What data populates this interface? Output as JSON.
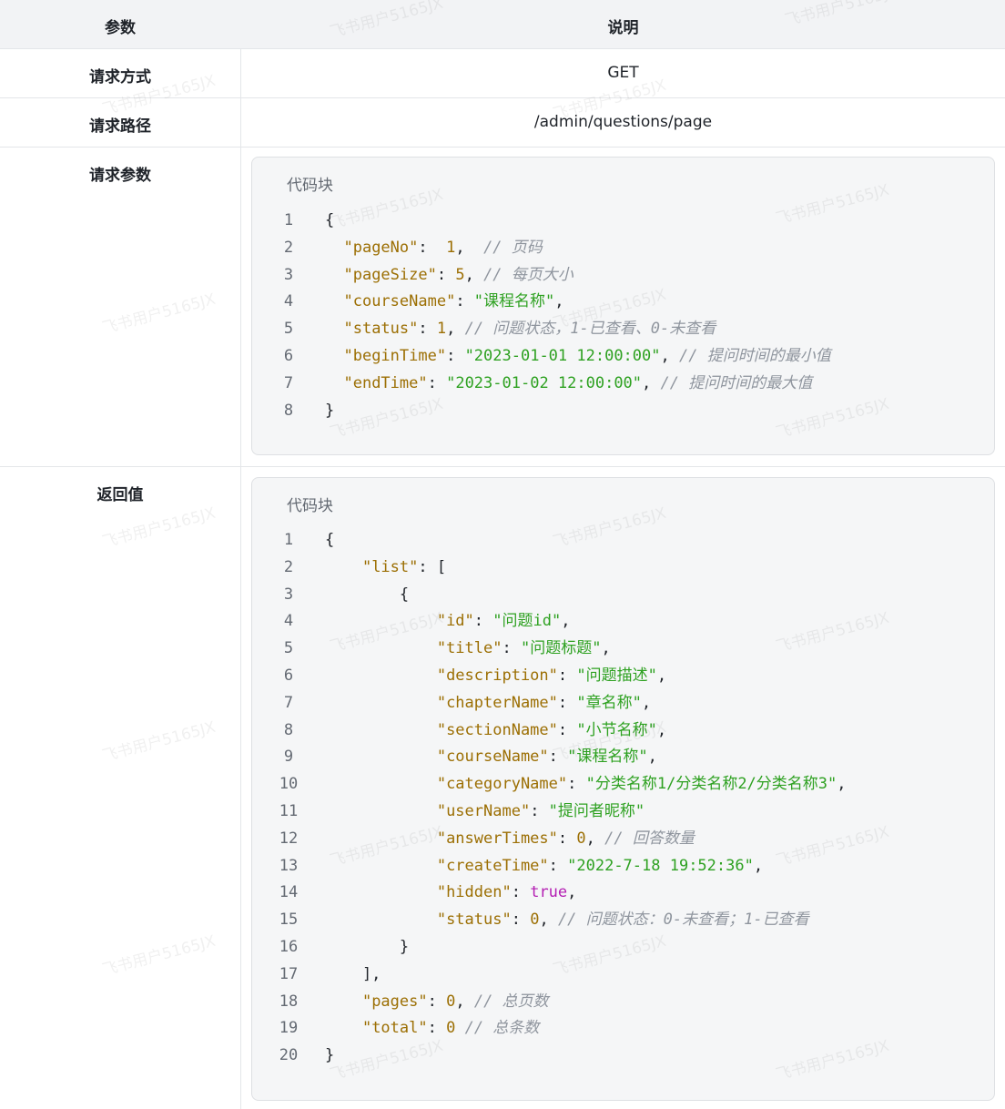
{
  "table": {
    "header": {
      "param": "参数",
      "desc": "说明"
    },
    "rows": [
      {
        "label": "请求方式",
        "value": "GET"
      },
      {
        "label": "请求路径",
        "value": "/admin/questions/page"
      }
    ],
    "request_params": {
      "label": "请求参数",
      "code_title": "代码块",
      "lines": [
        [
          [
            "pun",
            "{"
          ]
        ],
        [
          [
            "pun",
            "  "
          ],
          [
            "key",
            "\"pageNo\""
          ],
          [
            "pun",
            ":  "
          ],
          [
            "num",
            "1"
          ],
          [
            "pun",
            ",  "
          ],
          [
            "cmt",
            "// 页码"
          ]
        ],
        [
          [
            "pun",
            "  "
          ],
          [
            "key",
            "\"pageSize\""
          ],
          [
            "pun",
            ": "
          ],
          [
            "num",
            "5"
          ],
          [
            "pun",
            ", "
          ],
          [
            "cmt",
            "// 每页大小"
          ]
        ],
        [
          [
            "pun",
            "  "
          ],
          [
            "key",
            "\"courseName\""
          ],
          [
            "pun",
            ": "
          ],
          [
            "str",
            "\"课程名称\""
          ],
          [
            "pun",
            ","
          ]
        ],
        [
          [
            "pun",
            "  "
          ],
          [
            "key",
            "\"status\""
          ],
          [
            "pun",
            ": "
          ],
          [
            "num",
            "1"
          ],
          [
            "pun",
            ", "
          ],
          [
            "cmt",
            "// 问题状态，1-已查看、0-未查看"
          ]
        ],
        [
          [
            "pun",
            "  "
          ],
          [
            "key",
            "\"beginTime\""
          ],
          [
            "pun",
            ": "
          ],
          [
            "str",
            "\"2023-01-01 12:00:00\""
          ],
          [
            "pun",
            ", "
          ],
          [
            "cmt",
            "// 提问时间的最小值"
          ]
        ],
        [
          [
            "pun",
            "  "
          ],
          [
            "key",
            "\"endTime\""
          ],
          [
            "pun",
            ": "
          ],
          [
            "str",
            "\"2023-01-02 12:00:00\""
          ],
          [
            "pun",
            ", "
          ],
          [
            "cmt",
            "// 提问时间的最大值"
          ]
        ],
        [
          [
            "pun",
            "}"
          ]
        ]
      ]
    },
    "return_value": {
      "label": "返回值",
      "code_title": "代码块",
      "lines": [
        [
          [
            "pun",
            "{"
          ]
        ],
        [
          [
            "pun",
            "    "
          ],
          [
            "key",
            "\"list\""
          ],
          [
            "pun",
            ": ["
          ]
        ],
        [
          [
            "pun",
            "        {"
          ]
        ],
        [
          [
            "pun",
            "            "
          ],
          [
            "key",
            "\"id\""
          ],
          [
            "pun",
            ": "
          ],
          [
            "str",
            "\"问题id\""
          ],
          [
            "pun",
            ","
          ]
        ],
        [
          [
            "pun",
            "            "
          ],
          [
            "key",
            "\"title\""
          ],
          [
            "pun",
            ": "
          ],
          [
            "str",
            "\"问题标题\""
          ],
          [
            "pun",
            ","
          ]
        ],
        [
          [
            "pun",
            "            "
          ],
          [
            "key",
            "\"description\""
          ],
          [
            "pun",
            ": "
          ],
          [
            "str",
            "\"问题描述\""
          ],
          [
            "pun",
            ","
          ]
        ],
        [
          [
            "pun",
            "            "
          ],
          [
            "key",
            "\"chapterName\""
          ],
          [
            "pun",
            ": "
          ],
          [
            "str",
            "\"章名称\""
          ],
          [
            "pun",
            ","
          ]
        ],
        [
          [
            "pun",
            "            "
          ],
          [
            "key",
            "\"sectionName\""
          ],
          [
            "pun",
            ": "
          ],
          [
            "str",
            "\"小节名称\""
          ],
          [
            "pun",
            ","
          ]
        ],
        [
          [
            "pun",
            "            "
          ],
          [
            "key",
            "\"courseName\""
          ],
          [
            "pun",
            ": "
          ],
          [
            "str",
            "\"课程名称\""
          ],
          [
            "pun",
            ","
          ]
        ],
        [
          [
            "pun",
            "            "
          ],
          [
            "key",
            "\"categoryName\""
          ],
          [
            "pun",
            ": "
          ],
          [
            "str",
            "\"分类名称1/分类名称2/分类名称3\""
          ],
          [
            "pun",
            ","
          ]
        ],
        [
          [
            "pun",
            "            "
          ],
          [
            "key",
            "\"userName\""
          ],
          [
            "pun",
            ": "
          ],
          [
            "str",
            "\"提问者昵称\""
          ]
        ],
        [
          [
            "pun",
            "            "
          ],
          [
            "key",
            "\"answerTimes\""
          ],
          [
            "pun",
            ": "
          ],
          [
            "num",
            "0"
          ],
          [
            "pun",
            ", "
          ],
          [
            "cmt",
            "// 回答数量"
          ]
        ],
        [
          [
            "pun",
            "            "
          ],
          [
            "key",
            "\"createTime\""
          ],
          [
            "pun",
            ": "
          ],
          [
            "str",
            "\"2022-7-18 19:52:36\""
          ],
          [
            "pun",
            ","
          ]
        ],
        [
          [
            "pun",
            "            "
          ],
          [
            "key",
            "\"hidden\""
          ],
          [
            "pun",
            ": "
          ],
          [
            "bool",
            "true"
          ],
          [
            "pun",
            ","
          ]
        ],
        [
          [
            "pun",
            "            "
          ],
          [
            "key",
            "\"status\""
          ],
          [
            "pun",
            ": "
          ],
          [
            "num",
            "0"
          ],
          [
            "pun",
            ", "
          ],
          [
            "cmt",
            "// 问题状态：0-未查看；1-已查看"
          ]
        ],
        [
          [
            "pun",
            "        }"
          ]
        ],
        [
          [
            "pun",
            "    ],"
          ]
        ],
        [
          [
            "pun",
            "    "
          ],
          [
            "key",
            "\"pages\""
          ],
          [
            "pun",
            ": "
          ],
          [
            "num",
            "0"
          ],
          [
            "pun",
            ", "
          ],
          [
            "cmt",
            "// 总页数"
          ]
        ],
        [
          [
            "pun",
            "    "
          ],
          [
            "key",
            "\"total\""
          ],
          [
            "pun",
            ": "
          ],
          [
            "num",
            "0"
          ],
          [
            "pun",
            " "
          ],
          [
            "cmt",
            "// 总条数"
          ]
        ],
        [
          [
            "pun",
            "}"
          ]
        ]
      ]
    }
  },
  "watermark": "飞书用户5165JX"
}
